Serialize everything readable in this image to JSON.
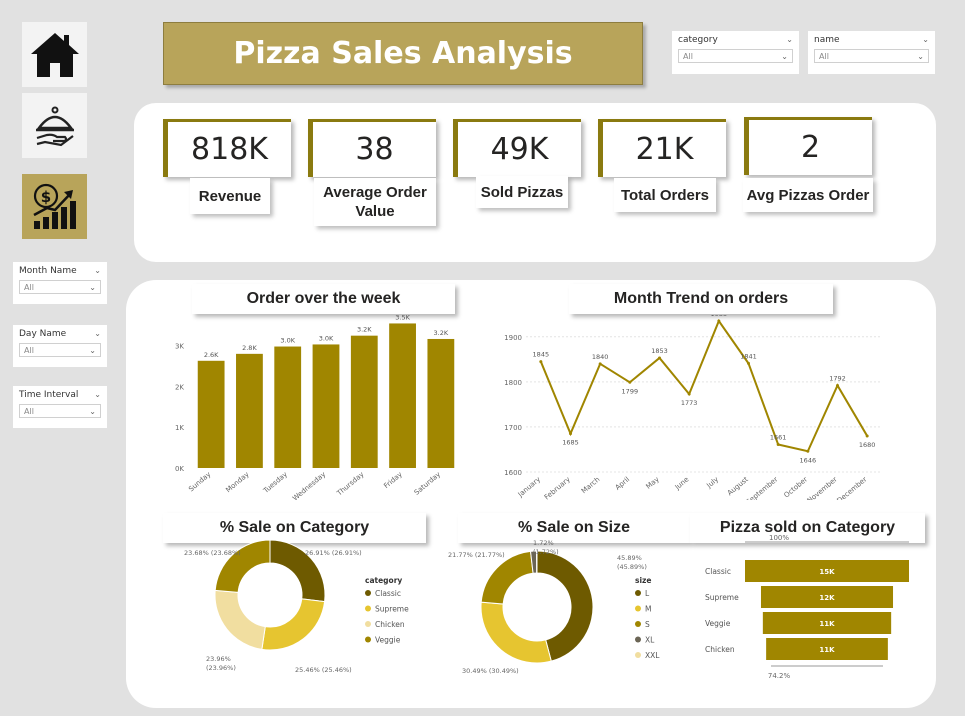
{
  "title": "Pizza Sales Analysis",
  "nav": [
    {
      "icon": "home-icon"
    },
    {
      "icon": "serving-tray-icon"
    },
    {
      "icon": "sales-growth-icon"
    }
  ],
  "colors": {
    "accent": "#b8a45a",
    "bar": "#a08600",
    "line": "#a08600",
    "background": "#e1e1e1"
  },
  "slicers": {
    "category": {
      "label": "category",
      "value": "All"
    },
    "name": {
      "label": "name",
      "value": "All"
    },
    "month_name": {
      "label": "Month Name",
      "value": "All"
    },
    "day_name": {
      "label": "Day Name",
      "value": "All"
    },
    "time_interval": {
      "label": "Time Interval",
      "value": "All"
    }
  },
  "kpis": {
    "revenue": {
      "value": "818K",
      "label": "Revenue"
    },
    "avg_order_value": {
      "value": "38",
      "label": "Average Order Value"
    },
    "sold_pizzas": {
      "value": "49K",
      "label": "Sold Pizzas"
    },
    "total_orders": {
      "value": "21K",
      "label": "Total Orders"
    },
    "avg_pizzas_order": {
      "value": "2",
      "label": "Avg Pizzas Order"
    }
  },
  "chart_titles": {
    "week": "Order over the week",
    "month": "Month Trend on orders",
    "category": "% Sale on Category",
    "size": "% Sale on Size",
    "funnel": "Pizza sold on Category"
  },
  "chart_data": [
    {
      "type": "bar",
      "title": "Order over the week",
      "categories": [
        "Sunday",
        "Monday",
        "Tuesday",
        "Wednesday",
        "Thursday",
        "Friday",
        "Saturday"
      ],
      "values": [
        2624,
        2794,
        2973,
        3024,
        3239,
        3538,
        3158
      ],
      "data_labels": [
        "2.6K",
        "2.8K",
        "3.0K",
        "3.0K",
        "3.2K",
        "3.5K",
        "3.2K"
      ],
      "y_ticks": [
        "0K",
        "1K",
        "2K",
        "3K"
      ],
      "ylim": [
        0,
        3500
      ]
    },
    {
      "type": "line",
      "title": "Month Trend on orders",
      "categories": [
        "January",
        "February",
        "March",
        "April",
        "May",
        "June",
        "July",
        "August",
        "September",
        "October",
        "November",
        "December"
      ],
      "values": [
        1845,
        1685,
        1840,
        1799,
        1853,
        1773,
        1935,
        1841,
        1661,
        1646,
        1792,
        1680
      ],
      "data_labels": [
        "1845",
        "1685",
        "1840",
        "1799",
        "1853",
        "1773",
        "1935",
        "1841",
        "1661",
        "1646",
        "1792",
        "1680"
      ],
      "y_ticks": [
        "1600",
        "1700",
        "1800",
        "1900"
      ],
      "ylim": [
        1600,
        1935
      ]
    },
    {
      "type": "pie",
      "title": "% Sale on Category",
      "legend_title": "category",
      "slices": [
        {
          "name": "Classic",
          "value": 26.91,
          "label": "26.91% (26.91%)",
          "color": "#6e5a00"
        },
        {
          "name": "Supreme",
          "value": 25.46,
          "label": "25.46% (25.46%)",
          "color": "#e6c530"
        },
        {
          "name": "Chicken",
          "value": 23.96,
          "label": "23.96% (23.96%)",
          "color": "#f1dea0"
        },
        {
          "name": "Veggie",
          "value": 23.68,
          "label": "23.68% (23.68%)",
          "color": "#a08600"
        }
      ]
    },
    {
      "type": "pie",
      "title": "% Sale on Size",
      "legend_title": "size",
      "slices": [
        {
          "name": "L",
          "value": 45.89,
          "label": "45.89% (45.89%)",
          "color": "#6e5a00"
        },
        {
          "name": "M",
          "value": 30.49,
          "label": "30.49% (30.49%)",
          "color": "#e6c530"
        },
        {
          "name": "S",
          "value": 21.77,
          "label": "21.77% (21.77%)",
          "color": "#a08600"
        },
        {
          "name": "XL",
          "value": 1.72,
          "label": "1.72% (1.72%)",
          "color": "#6b6555"
        },
        {
          "name": "XXL",
          "value": 0.12,
          "label": "",
          "color": "#f1dea0"
        }
      ]
    },
    {
      "type": "bar",
      "subtype": "funnel",
      "title": "Pizza sold on Category",
      "categories": [
        "Classic",
        "Supreme",
        "Veggie",
        "Chicken"
      ],
      "values": [
        14888,
        11987,
        11649,
        11050
      ],
      "data_labels": [
        "15K",
        "12K",
        "11K",
        "11K"
      ],
      "top_pct": "100%",
      "bottom_pct": "74.2%"
    }
  ]
}
